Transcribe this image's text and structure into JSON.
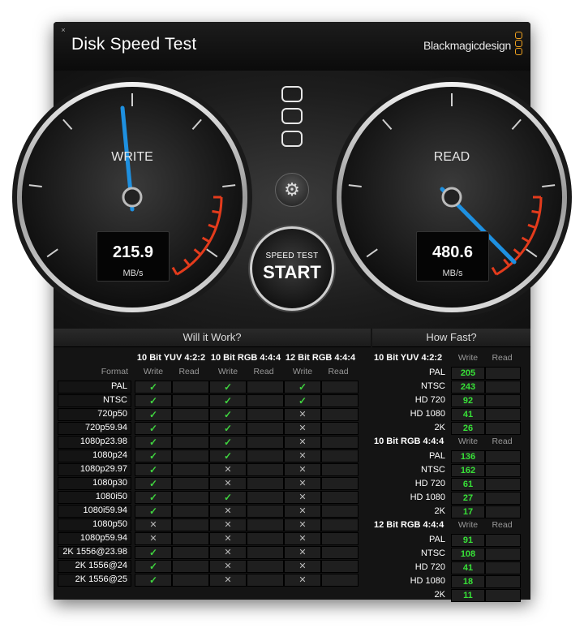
{
  "app": {
    "title": "Disk Speed Test",
    "brand": "Blackmagicdesign"
  },
  "gauges": {
    "write": {
      "label": "WRITE",
      "value": "215.9",
      "unit": "MB/s"
    },
    "read": {
      "label": "READ",
      "value": "480.6",
      "unit": "MB/s"
    }
  },
  "start_button": {
    "line1": "SPEED TEST",
    "line2": "START"
  },
  "will_it_work": {
    "header": "Will it Work?",
    "groups": [
      "10 Bit YUV 4:2:2",
      "10 Bit RGB 4:4:4",
      "12 Bit RGB 4:4:4"
    ],
    "format_label": "Format",
    "write_label": "Write",
    "read_label": "Read",
    "rows": [
      {
        "format": "PAL",
        "marks": [
          "y",
          "y",
          "y"
        ]
      },
      {
        "format": "NTSC",
        "marks": [
          "y",
          "y",
          "y"
        ]
      },
      {
        "format": "720p50",
        "marks": [
          "y",
          "y",
          "x"
        ]
      },
      {
        "format": "720p59.94",
        "marks": [
          "y",
          "y",
          "x"
        ]
      },
      {
        "format": "1080p23.98",
        "marks": [
          "y",
          "y",
          "x"
        ]
      },
      {
        "format": "1080p24",
        "marks": [
          "y",
          "y",
          "x"
        ]
      },
      {
        "format": "1080p29.97",
        "marks": [
          "y",
          "x",
          "x"
        ]
      },
      {
        "format": "1080p30",
        "marks": [
          "y",
          "x",
          "x"
        ]
      },
      {
        "format": "1080i50",
        "marks": [
          "y",
          "y",
          "x"
        ]
      },
      {
        "format": "1080i59.94",
        "marks": [
          "y",
          "x",
          "x"
        ]
      },
      {
        "format": "1080p50",
        "marks": [
          "x",
          "x",
          "x"
        ]
      },
      {
        "format": "1080p59.94",
        "marks": [
          "x",
          "x",
          "x"
        ]
      },
      {
        "format": "2K 1556@23.98",
        "marks": [
          "y",
          "x",
          "x"
        ]
      },
      {
        "format": "2K 1556@24",
        "marks": [
          "y",
          "x",
          "x"
        ]
      },
      {
        "format": "2K 1556@25",
        "marks": [
          "y",
          "x",
          "x"
        ]
      }
    ],
    "icons": {
      "yes": "checkmark-icon",
      "no": "cross-icon"
    },
    "colors": {
      "yes": "#3fd43f",
      "no": "#bbbbbb"
    }
  },
  "how_fast": {
    "header": "How Fast?",
    "write_label": "Write",
    "read_label": "Read",
    "groups": [
      {
        "name": "10 Bit YUV 4:2:2",
        "rows": [
          {
            "format": "PAL",
            "write": "205"
          },
          {
            "format": "NTSC",
            "write": "243"
          },
          {
            "format": "HD 720",
            "write": "92"
          },
          {
            "format": "HD 1080",
            "write": "41"
          },
          {
            "format": "2K",
            "write": "26"
          }
        ]
      },
      {
        "name": "10 Bit RGB 4:4:4",
        "rows": [
          {
            "format": "PAL",
            "write": "136"
          },
          {
            "format": "NTSC",
            "write": "162"
          },
          {
            "format": "HD 720",
            "write": "61"
          },
          {
            "format": "HD 1080",
            "write": "27"
          },
          {
            "format": "2K",
            "write": "17"
          }
        ]
      },
      {
        "name": "12 Bit RGB 4:4:4",
        "rows": [
          {
            "format": "PAL",
            "write": "91"
          },
          {
            "format": "NTSC",
            "write": "108"
          },
          {
            "format": "HD 720",
            "write": "41"
          },
          {
            "format": "HD 1080",
            "write": "18"
          },
          {
            "format": "2K",
            "write": "11"
          }
        ]
      }
    ]
  }
}
